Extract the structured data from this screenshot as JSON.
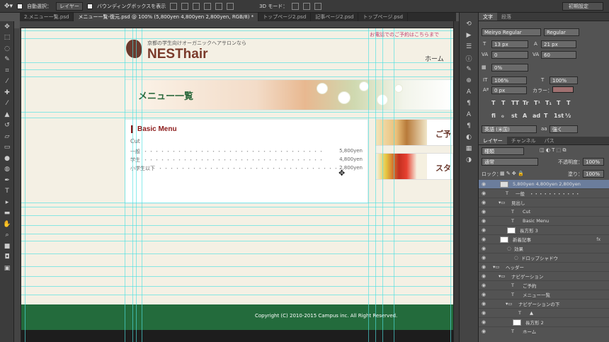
{
  "options_bar": {
    "auto_select_label": "自動選択：",
    "layer_dropdown": "レイヤー",
    "bbox_label": "バウンディングボックスを表示",
    "mode_3d": "3D モード：",
    "workspace": "初期設定"
  },
  "tabs": [
    {
      "label": "2.メニュー一覧.psd",
      "active": false
    },
    {
      "label": "メニュー一覧-復元.psd @ 100% (5,800yen 4,800yen 2,800yen, RGB/8) *",
      "active": true
    },
    {
      "label": "トップページ2.psd",
      "active": false
    },
    {
      "label": "記事ページ2.psd",
      "active": false
    },
    {
      "label": "トップページ.psd",
      "active": false
    }
  ],
  "tools": [
    "move-icon",
    "marquee-icon",
    "lasso-icon",
    "quick-select-icon",
    "crop-icon",
    "eyedropper-icon",
    "healing-icon",
    "brush-icon",
    "stamp-icon",
    "history-brush-icon",
    "eraser-icon",
    "gradient-icon",
    "blur-icon",
    "dodge-icon",
    "pen-icon",
    "type-icon",
    "path-select-icon",
    "shape-icon",
    "hand-icon",
    "zoom-icon",
    "color-swatch-icon",
    "quickmask-icon",
    "screen-mode-icon"
  ],
  "page": {
    "tagline": "京都の学生向けオーガニックヘアサロンなら",
    "logo": "NESThair",
    "top_link": "お電話でのご予約はこちらまで",
    "nav_home": "ホーム",
    "banner_title": "メニュー一覧",
    "menu_heading": "Basic Menu",
    "menu_category": "Cut",
    "menu_rows": [
      {
        "name": "一般",
        "dots": "・・・・・・・・・・・・・・・・・・・・・・・・・・・・・・・・",
        "price": "5,800yen"
      },
      {
        "name": "学生",
        "dots": "・・・・・・・・・・・・・・・・・・・・・・・・・・・・・・・・",
        "price": "4,800yen"
      },
      {
        "name": "小学生以下",
        "dots": "・・・・・・・・・・・・・・・・・・・・・・・・・・・・・・・・",
        "price": "2,800yen"
      }
    ],
    "side_cards": [
      "ご予",
      "スタ"
    ],
    "copyright": "Copyright (C) 2010-2015 Campus inc. All Right Reserved."
  },
  "char_panel": {
    "tabs": [
      "文字",
      "段落"
    ],
    "font_family": "Meiryo Regular",
    "font_style": "Regular",
    "font_size": "13 px",
    "leading": "21 px",
    "kerning": "0",
    "tracking": "60",
    "tsume": "0%",
    "vscale": "106%",
    "hscale": "100%",
    "baseline": "0 px",
    "color_label": "カラー：",
    "color": "#a07070",
    "type_buttons": [
      "T",
      "T",
      "TT",
      "Tr",
      "T¹",
      "T₁",
      "T",
      "T"
    ],
    "ot_buttons": [
      "fi",
      "ℴ",
      "st",
      "A",
      "ad",
      "T",
      "1st",
      "½"
    ],
    "language": "英語 (米国)",
    "aa": "強く"
  },
  "layers_panel": {
    "tabs": [
      "レイヤー",
      "チャンネル",
      "パス"
    ],
    "kind": "種類",
    "blend": "通常",
    "opacity_label": "不透明度：",
    "opacity": "100%",
    "lock_label": "ロック：",
    "fill_label": "塗り：",
    "fill": "100%",
    "layers": [
      {
        "name": "5,800yen 4,800yen 2,800yen",
        "type": "text",
        "indent": 0,
        "selected": true
      },
      {
        "name": "一般　・・・・・・・・・・・",
        "type": "text",
        "indent": 0,
        "selected": false
      },
      {
        "name": "見出し",
        "type": "folder",
        "indent": 0,
        "selected": false
      },
      {
        "name": "Cut",
        "type": "text",
        "indent": 1,
        "selected": false
      },
      {
        "name": "Basic Menu",
        "type": "text",
        "indent": 1,
        "selected": false
      },
      {
        "name": "長方形 3",
        "type": "shape",
        "indent": 1,
        "selected": false
      },
      {
        "name": "新着記事",
        "type": "shape",
        "indent": 0,
        "selected": false,
        "fx": "fx"
      },
      {
        "name": "効果",
        "type": "effect",
        "indent": 1,
        "selected": false
      },
      {
        "name": "ドロップシャドウ",
        "type": "effect",
        "indent": 2,
        "selected": false
      },
      {
        "name": "ヘッダー",
        "type": "folder",
        "indent": 0,
        "selected": false
      },
      {
        "name": "ナビゲーション",
        "type": "folder",
        "indent": 1,
        "selected": false
      },
      {
        "name": "ご予約",
        "type": "text",
        "indent": 2,
        "selected": false
      },
      {
        "name": "メニュー一覧",
        "type": "text",
        "indent": 2,
        "selected": false
      },
      {
        "name": "ナビゲーションの下",
        "type": "folder",
        "indent": 2,
        "selected": false
      },
      {
        "name": "▲",
        "type": "text",
        "indent": 3,
        "selected": false
      },
      {
        "name": "長方形 2",
        "type": "shape",
        "indent": 3,
        "selected": false
      },
      {
        "name": "ホーム",
        "type": "text",
        "indent": 2,
        "selected": false
      }
    ]
  }
}
